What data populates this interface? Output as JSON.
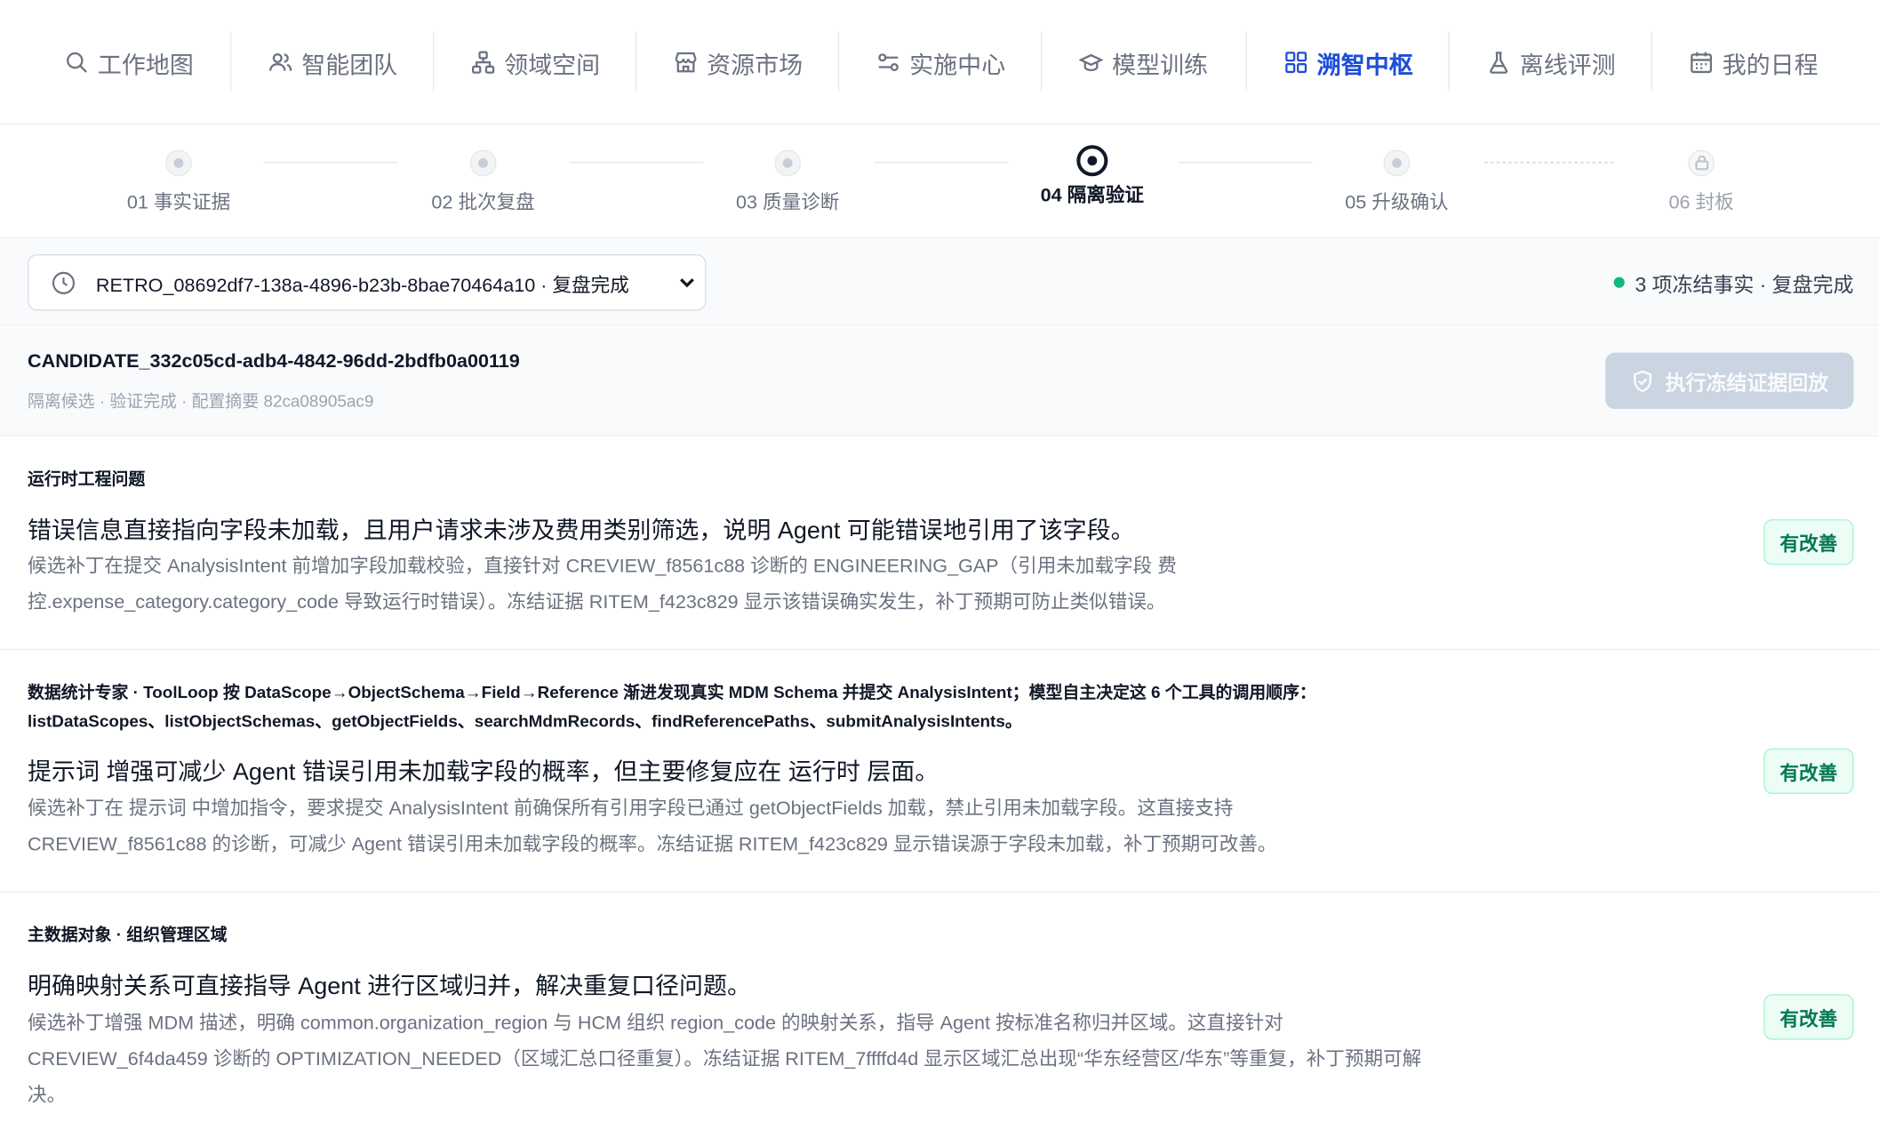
{
  "nav": {
    "items": [
      {
        "label": "工作地图",
        "icon": "search-icon"
      },
      {
        "label": "智能团队",
        "icon": "users-icon"
      },
      {
        "label": "领域空间",
        "icon": "network-icon"
      },
      {
        "label": "资源市场",
        "icon": "store-icon"
      },
      {
        "label": "实施中心",
        "icon": "sliders-icon"
      },
      {
        "label": "模型训练",
        "icon": "graduation-cap-icon"
      },
      {
        "label": "溯智中枢",
        "icon": "grid-icon",
        "active": true
      },
      {
        "label": "离线评测",
        "icon": "flask-icon"
      },
      {
        "label": "我的日程",
        "icon": "calendar-icon"
      }
    ]
  },
  "stepper": {
    "steps": [
      {
        "label": "01 事实证据",
        "state": "done"
      },
      {
        "label": "02 批次复盘",
        "state": "done"
      },
      {
        "label": "03 质量诊断",
        "state": "done"
      },
      {
        "label": "04 隔离验证",
        "state": "current"
      },
      {
        "label": "05 升级确认",
        "state": "pending"
      },
      {
        "label": "06 封板",
        "state": "locked"
      }
    ]
  },
  "retro": {
    "selected": "RETRO_08692df7-138a-4896-b23b-8bae70464a10 · 复盘完成",
    "status": "3 项冻结事实 · 复盘完成",
    "status_color": "#10b981"
  },
  "candidate": {
    "id": "CANDIDATE_332c05cd-adb4-4842-96dd-2bdfb0a00119",
    "meta": "隔离候选 · 验证完成 · 配置摘要 82ca08905ac9",
    "replay_button": "执行冻结证据回放"
  },
  "results": [
    {
      "category": "运行时工程问题",
      "headline": "错误信息直接指向字段未加载，且用户请求未涉及费用类别筛选，说明 Agent 可能错误地引用了该字段。",
      "detail": "候选补丁在提交 AnalysisIntent 前增加字段加载校验，直接针对 CREVIEW_f8561c88 诊断的 ENGINEERING_GAP（引用未加载字段 费控.expense_category.category_code 导致运行时错误）。冻结证据 RITEM_f423c829 显示该错误确实发生，补丁预期可防止类似错误。",
      "badge": "有改善"
    },
    {
      "category": "数据统计专家 · ToolLoop 按 DataScope→ObjectSchema→Field→Reference 渐进发现真实 MDM Schema 并提交 AnalysisIntent；模型自主决定这 6 个工具的调用顺序：listDataScopes、listObjectSchemas、getObjectFields、searchMdmRecords、findReferencePaths、submitAnalysisIntents。",
      "headline": "提示词 增强可减少 Agent 错误引用未加载字段的概率，但主要修复应在 运行时 层面。",
      "detail": "候选补丁在 提示词 中增加指令，要求提交 AnalysisIntent 前确保所有引用字段已通过 getObjectFields 加载，禁止引用未加载字段。这直接支持 CREVIEW_f8561c88 的诊断，可减少 Agent 错误引用未加载字段的概率。冻结证据 RITEM_f423c829 显示错误源于字段未加载，补丁预期可改善。",
      "badge": "有改善"
    },
    {
      "category": "主数据对象 · 组织管理区域",
      "headline": "明确映射关系可直接指导 Agent 进行区域归并，解决重复口径问题。",
      "detail": "候选补丁增强 MDM 描述，明确 common.organization_region 与 HCM 组织 region_code 的映射关系，指导 Agent 按标准名称归并区域。这直接针对 CREVIEW_6f4da459 诊断的 OPTIMIZATION_NEEDED（区域汇总口径重复）。冻结证据 RITEM_7ffffd4d 显示区域汇总出现“华东经营区/华东”等重复，补丁预期可解决。",
      "badge": "有改善"
    }
  ]
}
